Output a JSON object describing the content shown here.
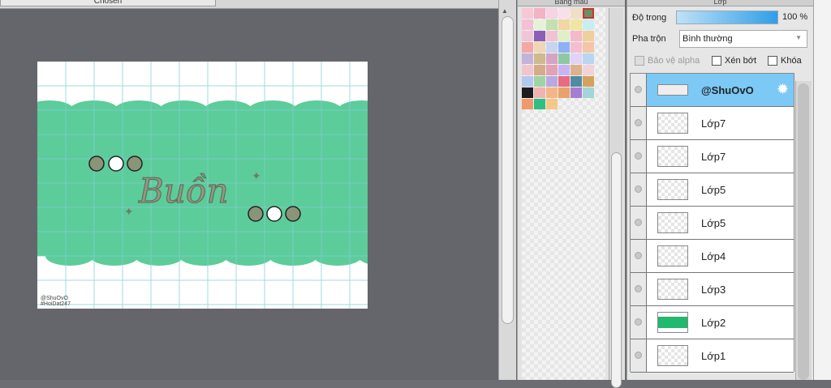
{
  "workspace": {
    "tab_label": "Chosen",
    "canvas": {
      "title_art": "Buồn",
      "watermark_line1": "@ShuOvO",
      "watermark_line2": "#HoiDat247",
      "band_color": "#5ccc9b"
    }
  },
  "palette_panel": {
    "title": "Bảng màu",
    "swatches": [
      "#f6c8d4",
      "#f4b2c6",
      "#f7d3e3",
      "#f8e0ea",
      "#f0dfc8",
      "#6c8f63",
      "#f4c0d5",
      "#e6f2d8",
      "#c4e0b0",
      "#f3d6a4",
      "#f0e6a0",
      "#c9eef0",
      "#f0c6d6",
      "#8b5fb5",
      "#f1c3d2",
      "#dff0c5",
      "#f6b9c9",
      "#f0cf9e",
      "#f3a8a8",
      "#efd6b5",
      "#c8d3f0",
      "#8fb0f5",
      "#f3bfd0",
      "#f2c6a7",
      "#c3b2d9",
      "#cfb98f",
      "#d7a3c5",
      "#8fc9a3",
      "#e0d3f5",
      "#b8d6f2",
      "#f2c5cc",
      "#d6ab8a",
      "#e2a1b4",
      "#c6b5f2",
      "#ddb28b",
      "#f0d3d9",
      "#b2c8ef",
      "#9fd3a4",
      "#b8a9e0",
      "#e86b84",
      "#4f8ba5",
      "#d4a15f",
      "#1d1d1d",
      "#f2b2b2",
      "#f5b587",
      "#e7a36d",
      "#a67ed1",
      "#a3d4d9",
      "#f09a6b",
      "#2fbf7f",
      "#f5c889"
    ],
    "selected_index": 5
  },
  "layer_panel": {
    "title": "Lớp",
    "opacity_label": "Độ trong",
    "opacity_value": "100 %",
    "opacity_level": 1.0,
    "blend_label": "Pha trộn",
    "blend_value": "Bình thường",
    "protect_alpha_label": "Bảo vệ alpha",
    "clipping_label": "Xén bớt",
    "lock_label": "Khóa",
    "layers": [
      {
        "name": "@ShuOvO",
        "active": true
      },
      {
        "name": "Lớp7",
        "active": false
      },
      {
        "name": "Lớp7",
        "active": false
      },
      {
        "name": "Lớp5",
        "active": false
      },
      {
        "name": "Lớp5",
        "active": false
      },
      {
        "name": "Lớp4",
        "active": false
      },
      {
        "name": "Lớp3",
        "active": false
      },
      {
        "name": "Lớp2",
        "active": false
      },
      {
        "name": "Lớp1",
        "active": false
      }
    ]
  }
}
